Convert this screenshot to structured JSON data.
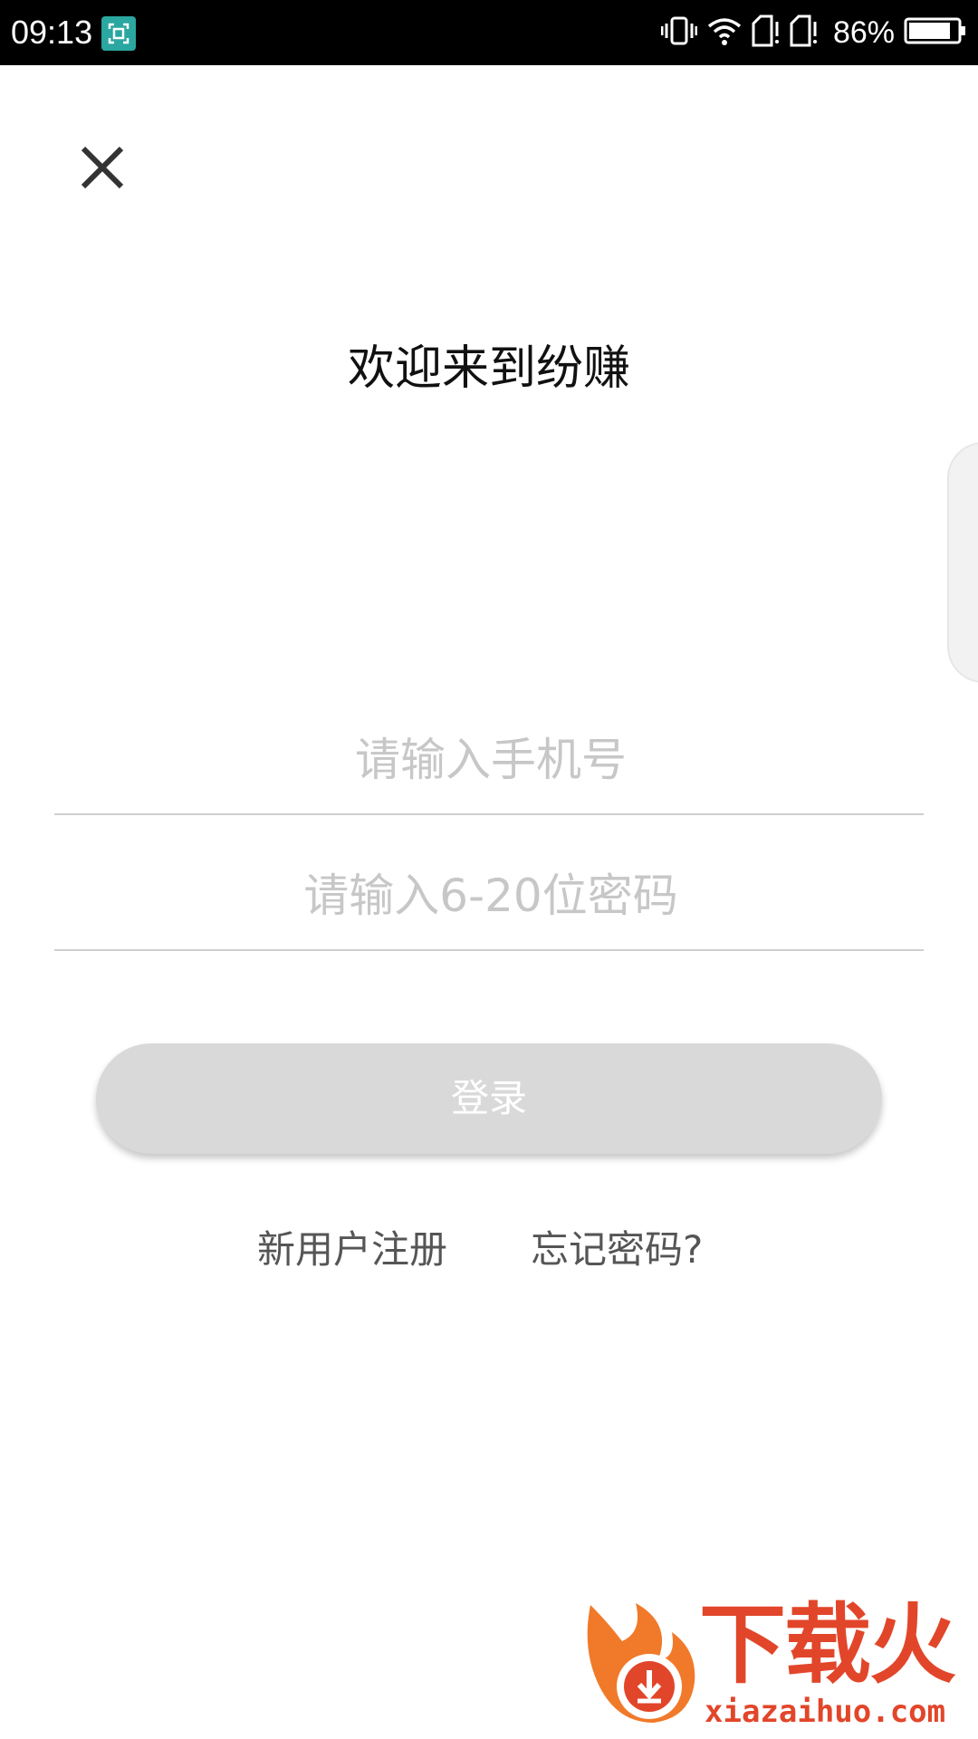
{
  "status_bar": {
    "time": "09:13",
    "battery": "86%"
  },
  "login": {
    "title": "欢迎来到纷赚",
    "phone_placeholder": "请输入手机号",
    "password_placeholder": "请输入6-20位密码",
    "login_label": "登录",
    "register_label": "新用户注册",
    "forgot_label": "忘记密码?"
  },
  "watermark": {
    "brand": "下载火",
    "url": "xiazaihuo.com"
  },
  "colors": {
    "status_bar_bg": "#000000",
    "button_disabled": "#d9d9d9",
    "placeholder": "#c7c7c7",
    "watermark": "#e2462a"
  },
  "icons": [
    "close-icon",
    "screenshot-icon",
    "vibrate-icon",
    "wifi-icon",
    "sim-card-icon",
    "battery-icon"
  ]
}
